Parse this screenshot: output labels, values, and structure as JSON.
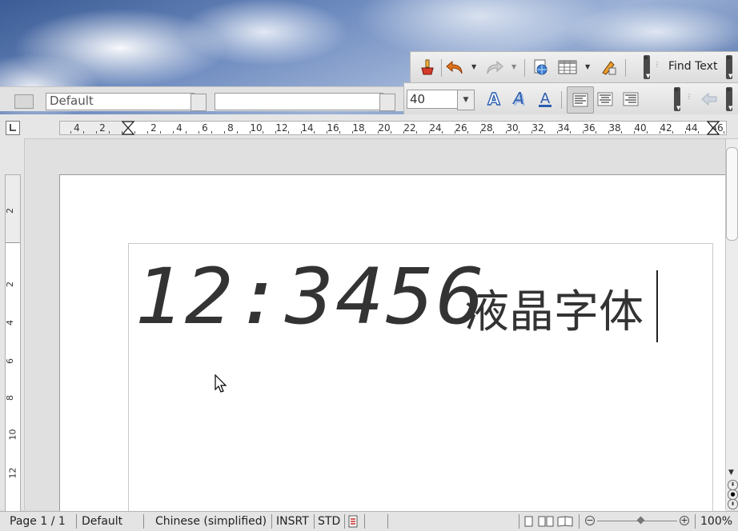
{
  "toolbar_top": {
    "find_label": "Find Text"
  },
  "toolbar_format": {
    "font_size": "40",
    "paragraph_style": "Default"
  },
  "ruler": {
    "h_labels": [
      "4",
      "2",
      "2",
      "4",
      "6",
      "8",
      "10",
      "12",
      "14",
      "16",
      "18",
      "20",
      "22",
      "24",
      "26",
      "28",
      "30",
      "32",
      "34",
      "36",
      "38",
      "40",
      "42",
      "44",
      "46"
    ],
    "v_labels": [
      "2",
      "2",
      "4",
      "6",
      "8",
      "10",
      "12"
    ]
  },
  "document": {
    "lcd_text": "12:3456",
    "cjk_text": "液晶字体"
  },
  "statusbar": {
    "page": "Page 1 / 1",
    "style": "Default",
    "language": "Chinese (simplified)",
    "insert_mode": "INSRT",
    "selection_mode": "STD",
    "zoom_value": 0.55,
    "zoom": "100%"
  },
  "colors": {
    "accent_blue": "#2a5db0",
    "undo_orange": "#e0731c"
  }
}
